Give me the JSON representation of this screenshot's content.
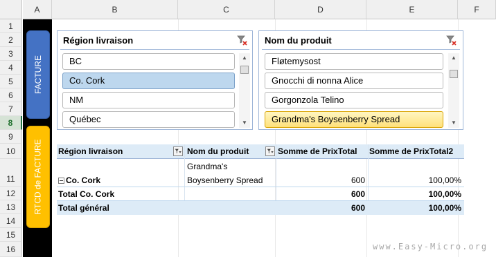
{
  "sheet": {
    "columns": [
      "A",
      "B",
      "C",
      "D",
      "E",
      "F"
    ],
    "rows": [
      "1",
      "2",
      "3",
      "4",
      "5",
      "6",
      "7",
      "8",
      "9",
      "10",
      "11",
      "12",
      "13",
      "14",
      "15",
      "16"
    ],
    "active_row": "8"
  },
  "side_buttons": {
    "facture": "FACTURE",
    "rtcd": "RTCD de FACTURE",
    "colors": {
      "facture": "#4472c4",
      "rtcd": "#ffc000",
      "panel": "#000000"
    }
  },
  "slicer_region": {
    "title": "Région livraison",
    "items": [
      "BC",
      "Co. Cork",
      "NM",
      "Québec"
    ],
    "selected": "Co. Cork"
  },
  "slicer_produit": {
    "title": "Nom du produit",
    "items": [
      "Fløtemysost",
      "Gnocchi di nonna Alice",
      "Gorgonzola Telino",
      "Grandma's Boysenberry Spread"
    ],
    "selected": "Grandma's Boysenberry Spread"
  },
  "pivot": {
    "headers": [
      "Région livraison",
      "Nom du produit",
      "Somme de PrixTotal",
      "Somme de PrixTotal2"
    ],
    "row_detail": {
      "region": "Co. Cork",
      "product_line1": "Grandma's",
      "product_line2": "Boysenberry Spread",
      "prixtotal": "600",
      "prixtotal2": "100,00%"
    },
    "row_total": {
      "label": "Total Co. Cork",
      "prixtotal": "600",
      "prixtotal2": "100,00%"
    },
    "row_grand": {
      "label": "Total général",
      "prixtotal": "600",
      "prixtotal2": "100,00%"
    }
  },
  "watermark": "www.Easy-Micro.org"
}
